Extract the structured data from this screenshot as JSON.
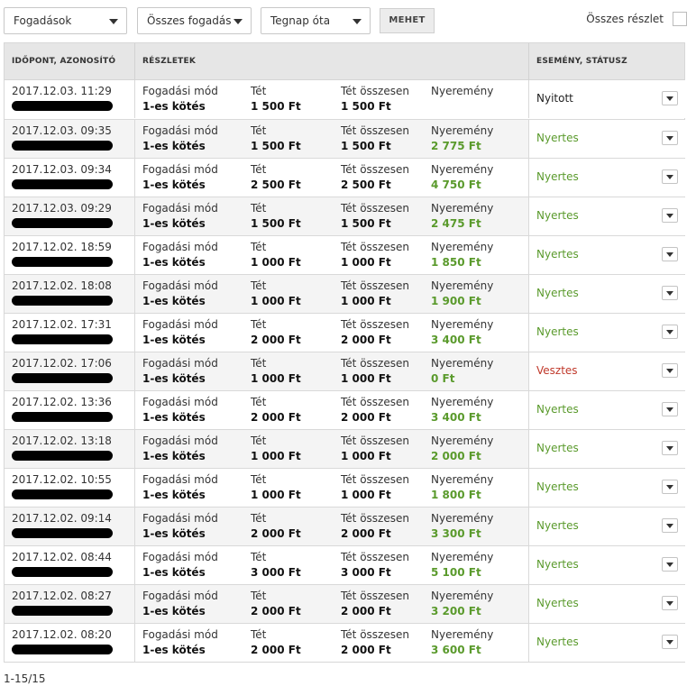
{
  "filters": {
    "bet_type": "Fogadások",
    "bet_scope": "Összes fogadás",
    "period": "Tegnap óta",
    "go_label": "MEHET",
    "all_details_label": "Összes részlet"
  },
  "columns": {
    "time_id": "IDŐPONT, AZONOSÍTÓ",
    "details": "RÉSZLETEK",
    "event_status": "ESEMÉNY, STÁTUSZ"
  },
  "field_labels": {
    "mode": "Fogadási mód",
    "stake": "Tét",
    "total": "Tét összesen",
    "winnings": "Nyeremény"
  },
  "rows": [
    {
      "time": "2017.12.03. 11:29",
      "mode": "1-es kötés",
      "stake": "1 500 Ft",
      "total": "1 500 Ft",
      "winnings": "",
      "status": "Nyitott",
      "status_type": "open"
    },
    {
      "time": "2017.12.03. 09:35",
      "mode": "1-es kötés",
      "stake": "1 500 Ft",
      "total": "1 500 Ft",
      "winnings": "2 775 Ft",
      "status": "Nyertes",
      "status_type": "win"
    },
    {
      "time": "2017.12.03. 09:34",
      "mode": "1-es kötés",
      "stake": "2 500 Ft",
      "total": "2 500 Ft",
      "winnings": "4 750 Ft",
      "status": "Nyertes",
      "status_type": "win"
    },
    {
      "time": "2017.12.03. 09:29",
      "mode": "1-es kötés",
      "stake": "1 500 Ft",
      "total": "1 500 Ft",
      "winnings": "2 475 Ft",
      "status": "Nyertes",
      "status_type": "win"
    },
    {
      "time": "2017.12.02. 18:59",
      "mode": "1-es kötés",
      "stake": "1 000 Ft",
      "total": "1 000 Ft",
      "winnings": "1 850 Ft",
      "status": "Nyertes",
      "status_type": "win"
    },
    {
      "time": "2017.12.02. 18:08",
      "mode": "1-es kötés",
      "stake": "1 000 Ft",
      "total": "1 000 Ft",
      "winnings": "1 900 Ft",
      "status": "Nyertes",
      "status_type": "win"
    },
    {
      "time": "2017.12.02. 17:31",
      "mode": "1-es kötés",
      "stake": "2 000 Ft",
      "total": "2 000 Ft",
      "winnings": "3 400 Ft",
      "status": "Nyertes",
      "status_type": "win"
    },
    {
      "time": "2017.12.02. 17:06",
      "mode": "1-es kötés",
      "stake": "1 000 Ft",
      "total": "1 000 Ft",
      "winnings": "0 Ft",
      "status": "Vesztes",
      "status_type": "lose"
    },
    {
      "time": "2017.12.02. 13:36",
      "mode": "1-es kötés",
      "stake": "2 000 Ft",
      "total": "2 000 Ft",
      "winnings": "3 400 Ft",
      "status": "Nyertes",
      "status_type": "win"
    },
    {
      "time": "2017.12.02. 13:18",
      "mode": "1-es kötés",
      "stake": "1 000 Ft",
      "total": "1 000 Ft",
      "winnings": "2 000 Ft",
      "status": "Nyertes",
      "status_type": "win"
    },
    {
      "time": "2017.12.02. 10:55",
      "mode": "1-es kötés",
      "stake": "1 000 Ft",
      "total": "1 000 Ft",
      "winnings": "1 800 Ft",
      "status": "Nyertes",
      "status_type": "win"
    },
    {
      "time": "2017.12.02. 09:14",
      "mode": "1-es kötés",
      "stake": "2 000 Ft",
      "total": "2 000 Ft",
      "winnings": "3 300 Ft",
      "status": "Nyertes",
      "status_type": "win"
    },
    {
      "time": "2017.12.02. 08:44",
      "mode": "1-es kötés",
      "stake": "3 000 Ft",
      "total": "3 000 Ft",
      "winnings": "5 100 Ft",
      "status": "Nyertes",
      "status_type": "win"
    },
    {
      "time": "2017.12.02. 08:27",
      "mode": "1-es kötés",
      "stake": "2 000 Ft",
      "total": "2 000 Ft",
      "winnings": "3 200 Ft",
      "status": "Nyertes",
      "status_type": "win"
    },
    {
      "time": "2017.12.02. 08:20",
      "mode": "1-es kötés",
      "stake": "2 000 Ft",
      "total": "2 000 Ft",
      "winnings": "3 600 Ft",
      "status": "Nyertes",
      "status_type": "win"
    }
  ],
  "pagination": "1-15/15",
  "colors": {
    "win": "#5a9a2c",
    "lose": "#c0392b",
    "header_bg": "#e6e6e6",
    "alt_row": "#f4f4f4"
  }
}
